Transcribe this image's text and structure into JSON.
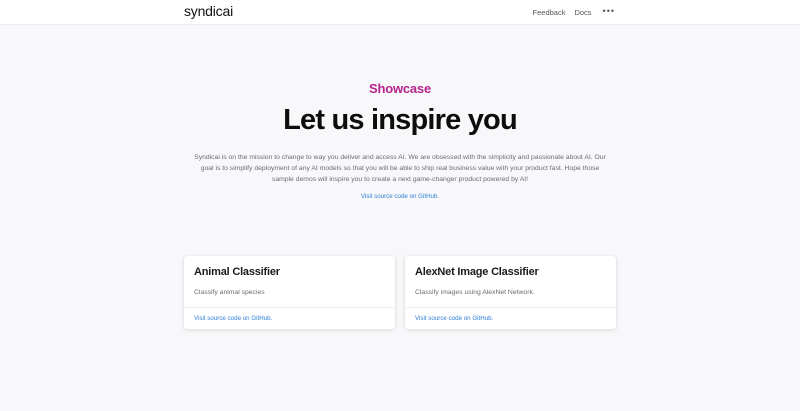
{
  "header": {
    "logo": "syndicai",
    "nav": {
      "feedback": "Feedback",
      "docs": "Docs",
      "more_icon": "more-horizontal-icon"
    }
  },
  "hero": {
    "eyebrow": "Showcase",
    "headline": "Let us inspire you",
    "intro": "Syndicai is on the mission to change to way you deliver and access AI. We are obsessed with the simplicity and passionate about AI. Our goal is to simplify deployment of any AI models so that you will be able to ship real business value with your product fast. Hope those sample demos will inspire you to create a next game-changer product powered by AI!",
    "link": "Visit source code on GitHub."
  },
  "cards": [
    {
      "title": "Animal Classifier",
      "description": "Classify animal species",
      "link": "Visit source code on GitHub."
    },
    {
      "title": "AlexNet Image Classifier",
      "description": "Classify images using AlexNet Network.",
      "link": "Visit source code on GitHub."
    }
  ],
  "colors": {
    "accent": "#b5238c",
    "link": "#2f7fd6",
    "background": "#f8f8fa"
  }
}
